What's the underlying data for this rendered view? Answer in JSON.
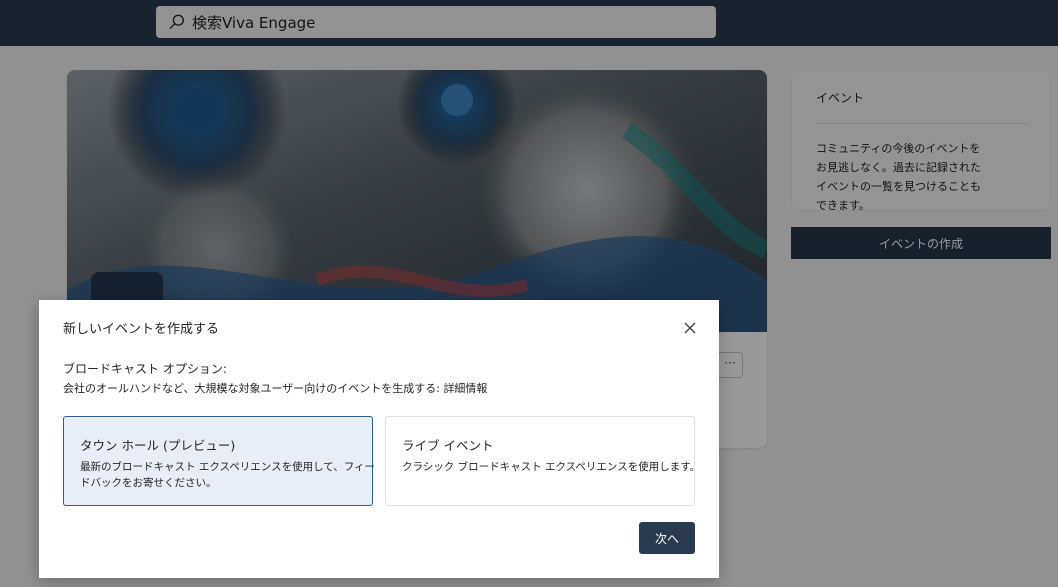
{
  "search": {
    "label": "検索Viva Engage"
  },
  "sidebar": {
    "events_title": "イベント",
    "events_description": "コミュニティの今後のイベントをお見逃しなく。過去に記録されたイベントの一覧を見つけることもできます。",
    "create_event_label": "イベントの作成"
  },
  "hero": {
    "more_label": "···"
  },
  "dialog": {
    "title": "新しいイベントを作成する",
    "options_heading": "ブロードキャスト オプション:",
    "options_description": "会社のオールハンドなど、大規模な対象ユーザー向けのイベントを生成する:",
    "learn_more": "詳細情報",
    "options": [
      {
        "label": "タウン ホール (プレビュー)",
        "description": "最新のブロードキャスト エクスペリエンスを使用して、フィードバックをお寄せください。",
        "selected": true
      },
      {
        "label": "ライブ イベント",
        "description": "クラシック ブロードキャスト エクスペリエンスを使用します。",
        "selected": false
      }
    ],
    "next_label": "次へ"
  },
  "colors": {
    "topbar": "#2b3b4f",
    "primary_button": "#2b3b4f",
    "selected_border": "#2f5f8f",
    "selected_fill": "#e8eef7"
  }
}
